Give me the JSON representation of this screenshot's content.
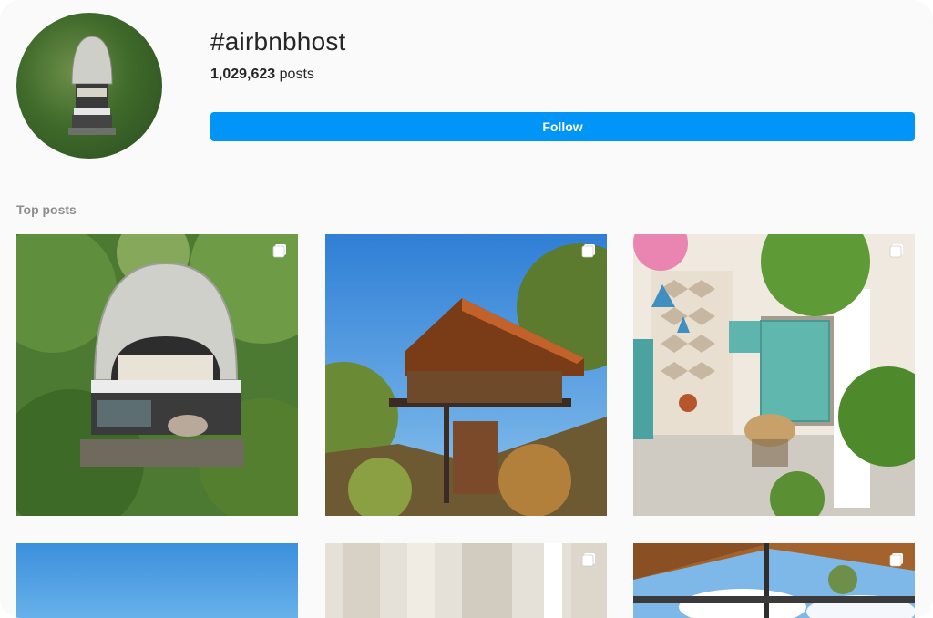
{
  "header": {
    "hashtag": "#airbnbhost",
    "post_count": "1,029,623",
    "posts_word": "posts",
    "follow_label": "Follow"
  },
  "section": {
    "top_posts_label": "Top posts"
  },
  "colors": {
    "accent": "#0095f6",
    "muted_text": "#8e8e8e",
    "background": "#fafafa"
  },
  "posts": [
    {
      "name": "post-arched-cabin-forest",
      "icon": "multiple-images-icon"
    },
    {
      "name": "post-wooden-house-hillside",
      "icon": "multiple-images-icon"
    },
    {
      "name": "post-patio-turquoise-shutters",
      "icon": "multiple-images-icon"
    },
    {
      "name": "post-blue-sky",
      "icon": "none"
    },
    {
      "name": "post-white-curtains",
      "icon": "multiple-images-icon"
    },
    {
      "name": "post-wooden-roof-view",
      "icon": "multiple-images-icon"
    }
  ]
}
